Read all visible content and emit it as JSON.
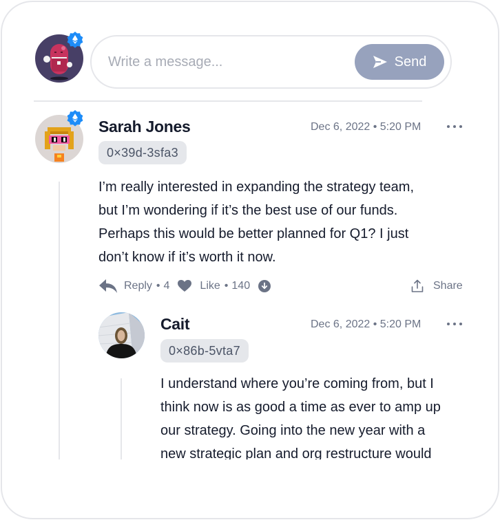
{
  "composer": {
    "placeholder": "Write a message...",
    "send_label": "Send",
    "avatar": "user-avatar-pink-character",
    "verified_badge": "ethereum-verified-badge"
  },
  "comments": [
    {
      "author": "Sarah Jones",
      "address": "0×39d-3sfa3",
      "timestamp": "Dec 6, 2022 • 5:20 PM",
      "verified": true,
      "avatar": "pixel-art-avatar",
      "lines": [
        "I’m really interested in expanding the strategy team,",
        "but I’m wondering if it’s the best use of our funds.",
        "Perhaps this would be better planned for Q1? I just",
        "don’t know if it’s worth it now."
      ],
      "actions": {
        "reply_label": "Reply",
        "reply_count": "4",
        "like_label": "Like",
        "like_count": "140",
        "share_label": "Share",
        "separator": "•"
      }
    },
    {
      "author": "Cait",
      "address": "0×86b-5vta7",
      "timestamp": "Dec 6, 2022 • 5:20 PM",
      "verified": false,
      "avatar": "photo-avatar",
      "lines": [
        "I understand where you’re coming from, but I",
        "think now is as good a time as ever to amp up",
        "our strategy. Going into the new year with a",
        "new strategic plan and org restructure would"
      ]
    }
  ],
  "colors": {
    "send_button": "#97a2bd",
    "verified_badge": "#1d8cf8",
    "text_primary": "#151b2c",
    "text_muted": "#6b7386",
    "border": "#e5e6ea",
    "address_pill": "#e5e7eb"
  }
}
